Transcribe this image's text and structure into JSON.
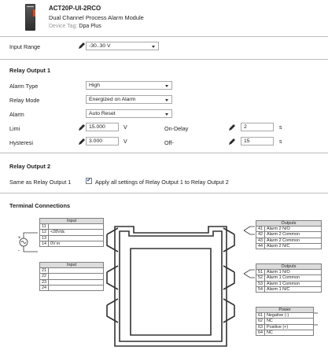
{
  "device": {
    "model": "ACT20P-UI-2RCO",
    "description": "Dual Channel Process Alarm Module",
    "tag_label": "Device Tag:",
    "tag_value": "Dpa Plus"
  },
  "input_range": {
    "label": "Input Range",
    "value": "-30..30 V"
  },
  "relay1": {
    "title": "Relay Output 1",
    "alarm_type": {
      "label": "Alarm Type",
      "value": "High"
    },
    "relay_mode": {
      "label": "Relay Mode",
      "value": "Energized on Alarm"
    },
    "alarm": {
      "label": "Alarm",
      "value": "Auto Reset"
    },
    "limit": {
      "label": "Limi",
      "value": "15.000",
      "unit": "V"
    },
    "hysteresis": {
      "label": "Hysteresi",
      "value": "3.000",
      "unit": "V"
    },
    "on_delay": {
      "label": "On-Delay",
      "value": "2",
      "unit": "s"
    },
    "off_delay": {
      "label": "Off-",
      "value": "15",
      "unit": "s"
    }
  },
  "relay2": {
    "title": "Relay Output 2",
    "same_label": "Same as Relay Output 1",
    "checkbox_label": "Apply all settings of Relay Output 1 to Relay Output 2"
  },
  "terminals": {
    "title": "Terminal Connections",
    "input1": {
      "header": "Input",
      "rows": [
        {
          "num": "11",
          "text": ""
        },
        {
          "num": "12",
          "text": "<28Vdc"
        },
        {
          "num": "13",
          "text": ""
        },
        {
          "num": "14",
          "text": "0V in"
        }
      ]
    },
    "input2": {
      "header": "Input",
      "rows": [
        {
          "num": "21",
          "text": ""
        },
        {
          "num": "22",
          "text": ""
        },
        {
          "num": "23",
          "text": ""
        },
        {
          "num": "24",
          "text": ""
        }
      ]
    },
    "outputs1": {
      "header": "Outputs",
      "rows": [
        {
          "num": "41",
          "text": "Alarm 2 N/O"
        },
        {
          "num": "42",
          "text": "Alarm 2 Common"
        },
        {
          "num": "43",
          "text": "Alarm 2 Common"
        },
        {
          "num": "44",
          "text": "Alarm 2 N/C"
        }
      ]
    },
    "outputs2": {
      "header": "Outputs",
      "rows": [
        {
          "num": "51",
          "text": "Alarm 1 N/O"
        },
        {
          "num": "52",
          "text": "Alarm 1 Common"
        },
        {
          "num": "53",
          "text": "Alarm 1 Common"
        },
        {
          "num": "54",
          "text": "Alarm 1 N/C"
        }
      ]
    },
    "power": {
      "header": "Power",
      "rows": [
        {
          "num": "61",
          "text": "Negative (-)"
        },
        {
          "num": "62",
          "text": "NC"
        },
        {
          "num": "63",
          "text": "Positive (+)"
        },
        {
          "num": "64",
          "text": "NC"
        }
      ]
    },
    "plus_sign": "+",
    "minus_sign": "-"
  },
  "icons": {
    "edit": "pencil-icon",
    "dropdown": "chevron-down-icon",
    "check": "checkmark-icon"
  }
}
